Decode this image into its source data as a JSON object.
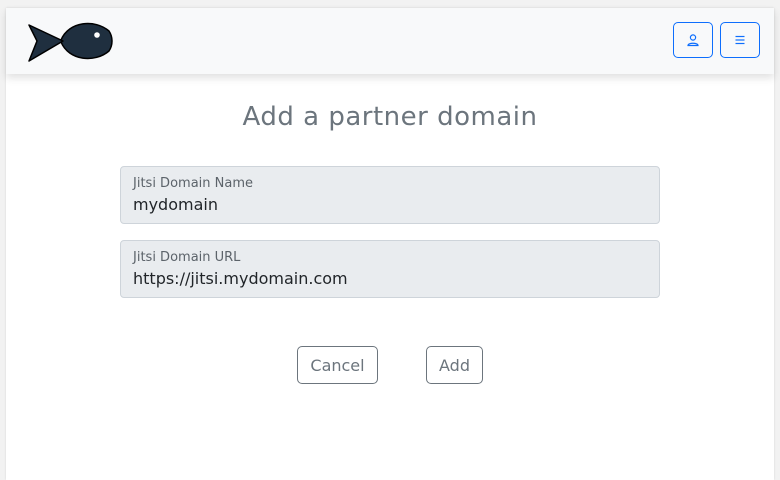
{
  "header": {
    "logo_icon": "fish-logo-icon",
    "user_button_icon": "user-icon",
    "menu_button_icon": "hamburger-menu-icon",
    "accent_color": "#0d6efd"
  },
  "main": {
    "title": "Add a partner domain",
    "fields": [
      {
        "label": "Jitsi Domain Name",
        "value": "mydomain"
      },
      {
        "label": "Jitsi Domain URL",
        "value": "https://jitsi.mydomain.com"
      }
    ],
    "cancel_label": "Cancel",
    "add_label": "Add"
  }
}
